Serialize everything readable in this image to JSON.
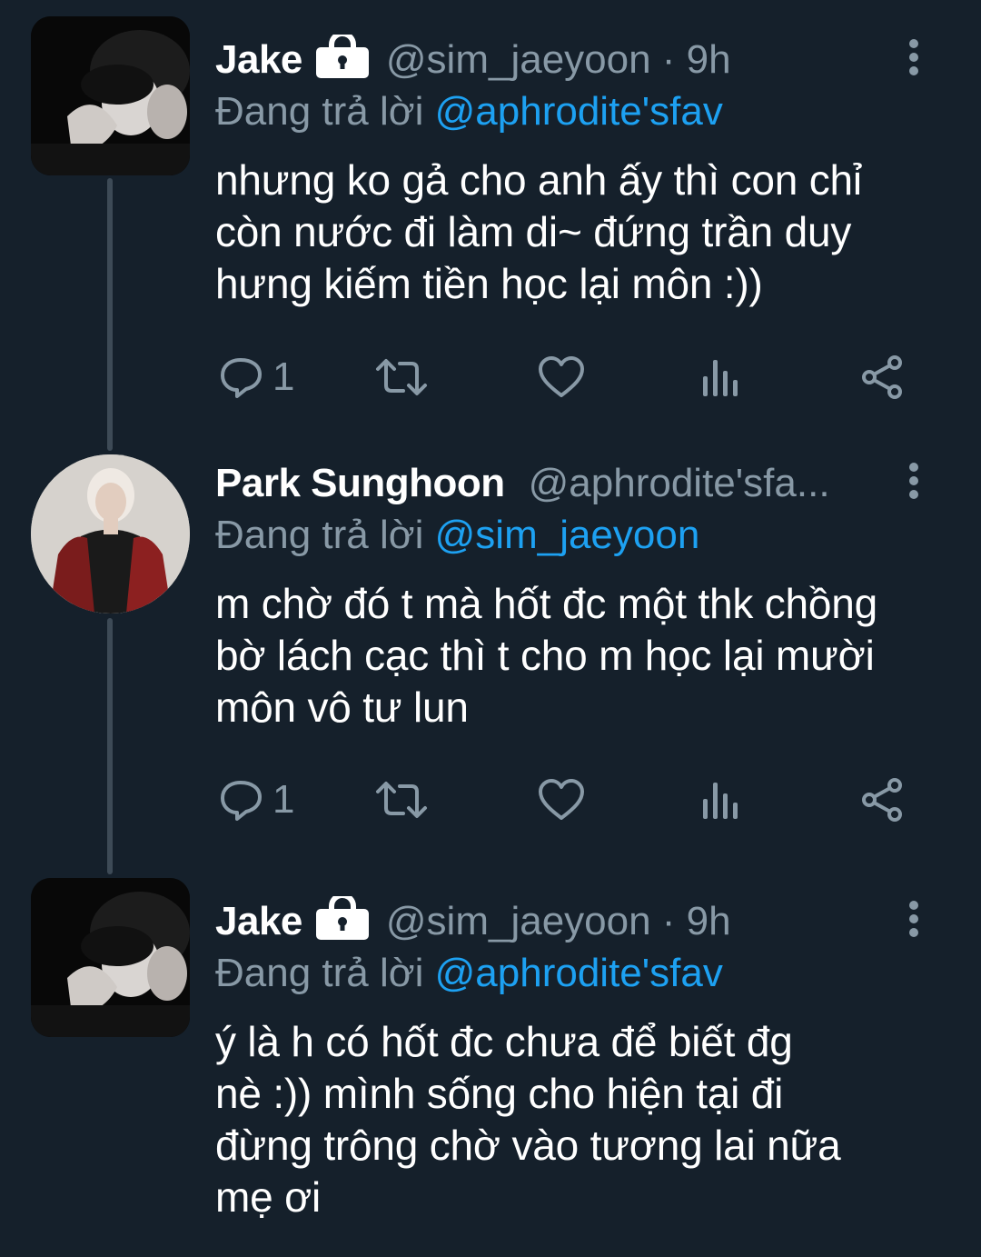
{
  "tweets": [
    {
      "name": "Jake",
      "protected": true,
      "handle": "@sim_jaeyoon · 9h",
      "reply_prefix": "Đang trả lời ",
      "reply_to": "@aphrodite'sfav",
      "text": "nhưng ko gả cho anh ấy thì con chỉ\ncòn nước đi làm di~ đứng trần duy\nhưng kiếm tiền học lại môn :))",
      "reply_count": "1"
    },
    {
      "name": "Park Sunghoon",
      "protected": false,
      "handle": "@aphrodite'sfa...",
      "reply_prefix": "Đang trả lời ",
      "reply_to": "@sim_jaeyoon",
      "text": "m chờ đó t mà hốt đc một thk chồng\nbờ lách cạc thì t cho m học lại mười\nmôn vô tư lun",
      "reply_count": "1"
    },
    {
      "name": "Jake",
      "protected": true,
      "handle": "@sim_jaeyoon · 9h",
      "reply_prefix": "Đang trả lời ",
      "reply_to": "@aphrodite'sfav",
      "text": "ý là h có hốt đc chưa để biết đg\nnè :)) mình sống cho hiện tại đi\nđừng trông chờ vào tương lai nữa\nmẹ ơi"
    }
  ],
  "icons": {
    "reply": "reply-icon",
    "retweet": "retweet-icon",
    "like": "heart-icon",
    "analytics": "analytics-icon",
    "share": "share-icon",
    "more": "more-vertical-icon",
    "lock": "lock-icon"
  },
  "colors": {
    "background": "#15202b",
    "secondary_text": "#8899a6",
    "mention": "#1da1f2",
    "thread_line": "#3d4a56"
  }
}
